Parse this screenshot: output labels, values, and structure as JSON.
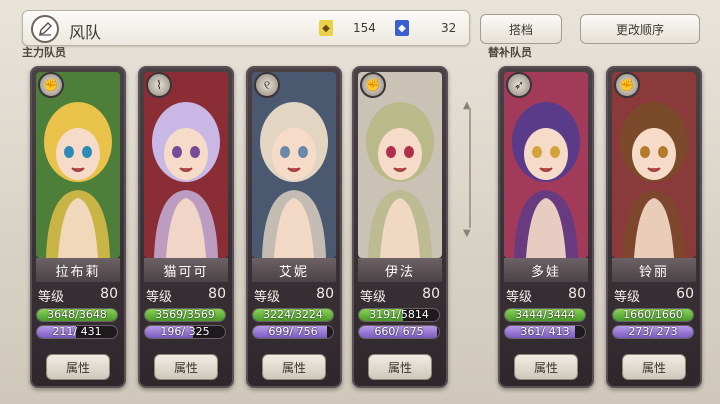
{
  "header": {
    "party_name": "风队",
    "resource1_icon": "crystal-gold-icon",
    "resource1_value": "154",
    "resource2_icon": "crystal-blue-icon",
    "resource2_value": "32",
    "deploy_label": "搭档",
    "reorder_label": "更改顺序"
  },
  "sections": {
    "main_label": "主力队员",
    "sub_label": "替补队员"
  },
  "members": [
    {
      "name": "拉布莉",
      "level_label": "等级",
      "level": "80",
      "hp": "3648/3648",
      "hp_frac": 1.0,
      "mp": "211/ 431",
      "mp_frac": 0.49,
      "attr_label": "属性",
      "type_icon": "fist-icon",
      "hair": "#e9c24a",
      "bg": "#4d7f3a",
      "eyes": "#2d8bb8"
    },
    {
      "name": "猫可可",
      "level_label": "等级",
      "level": "80",
      "hp": "3569/3569",
      "hp_frac": 1.0,
      "mp": "196/ 325",
      "mp_frac": 0.6,
      "attr_label": "属性",
      "type_icon": "claw-icon",
      "hair": "#c9b8e6",
      "bg": "#8a2d35",
      "eyes": "#7a4a9a"
    },
    {
      "name": "艾妮",
      "level_label": "等级",
      "level": "80",
      "hp": "3224/3224",
      "hp_frac": 1.0,
      "mp": "699/ 756",
      "mp_frac": 0.92,
      "attr_label": "属性",
      "type_icon": "spiral-icon",
      "hair": "#e2d6c3",
      "bg": "#4a5870",
      "eyes": "#6a88a8"
    },
    {
      "name": "伊法",
      "level_label": "等级",
      "level": "80",
      "hp": "3191/5814",
      "hp_frac": 0.55,
      "mp": "660/ 675",
      "mp_frac": 0.98,
      "attr_label": "属性",
      "type_icon": "fist-icon",
      "hair": "#b9b98a",
      "bg": "#c9c2b5",
      "eyes": "#b0304a"
    },
    {
      "name": "多娃",
      "level_label": "等级",
      "level": "80",
      "hp": "3444/3444",
      "hp_frac": 1.0,
      "mp": "361/ 413",
      "mp_frac": 0.87,
      "attr_label": "属性",
      "type_icon": "bow-icon",
      "hair": "#5a3b8a",
      "bg": "#a23a5a",
      "eyes": "#d4a23a"
    },
    {
      "name": "铃丽",
      "level_label": "等级",
      "level": "60",
      "hp": "1660/1660",
      "hp_frac": 1.0,
      "mp": "273/ 273",
      "mp_frac": 1.0,
      "attr_label": "属性",
      "type_icon": "fist-icon",
      "hair": "#7a4a2a",
      "bg": "#8a3a3a",
      "eyes": "#b57a2a"
    }
  ]
}
